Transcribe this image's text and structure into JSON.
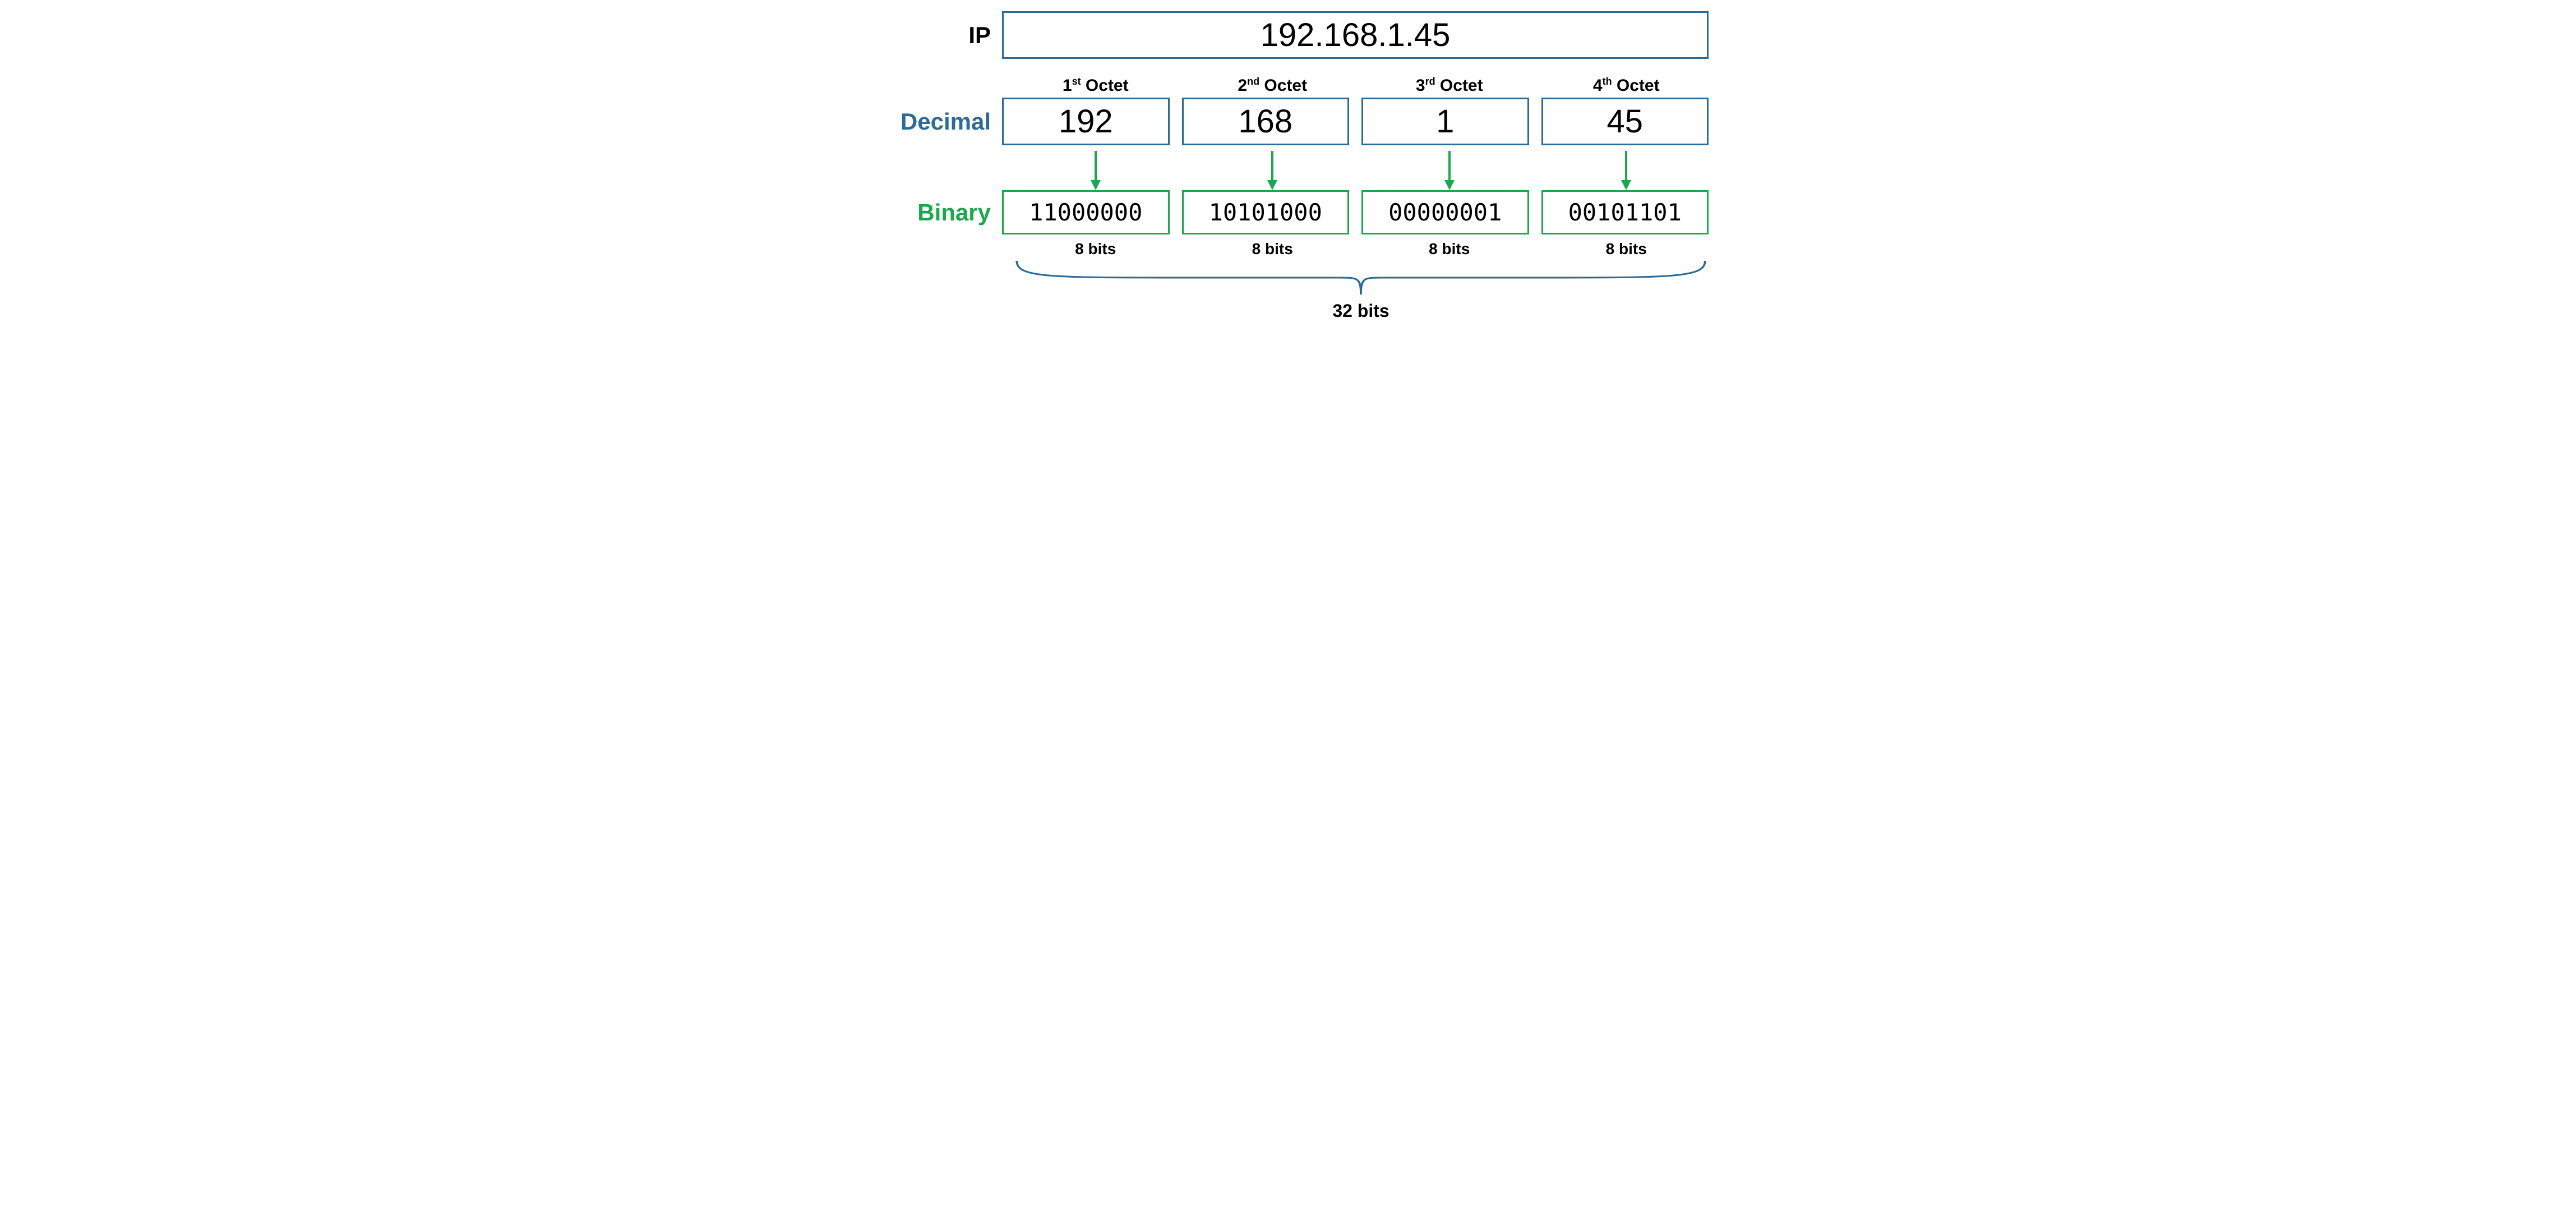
{
  "labels": {
    "ip": "IP",
    "decimal": "Decimal",
    "binary": "Binary"
  },
  "ip_address": "192.168.1.45",
  "octets": [
    {
      "ordinal_num": "1",
      "ordinal_suffix": "st",
      "ordinal_word": "Octet",
      "decimal": "192",
      "binary": "11000000",
      "bits": "8 bits"
    },
    {
      "ordinal_num": "2",
      "ordinal_suffix": "nd",
      "ordinal_word": "Octet",
      "decimal": "168",
      "binary": "10101000",
      "bits": "8 bits"
    },
    {
      "ordinal_num": "3",
      "ordinal_suffix": "rd",
      "ordinal_word": "Octet",
      "decimal": "1",
      "binary": "00000001",
      "bits": "8 bits"
    },
    {
      "ordinal_num": "4",
      "ordinal_suffix": "th",
      "ordinal_word": "Octet",
      "decimal": "45",
      "binary": "00101101",
      "bits": "8 bits"
    }
  ],
  "total_bits": "32 bits",
  "colors": {
    "blue": "#2A6B9A",
    "green": "#19A84B"
  }
}
